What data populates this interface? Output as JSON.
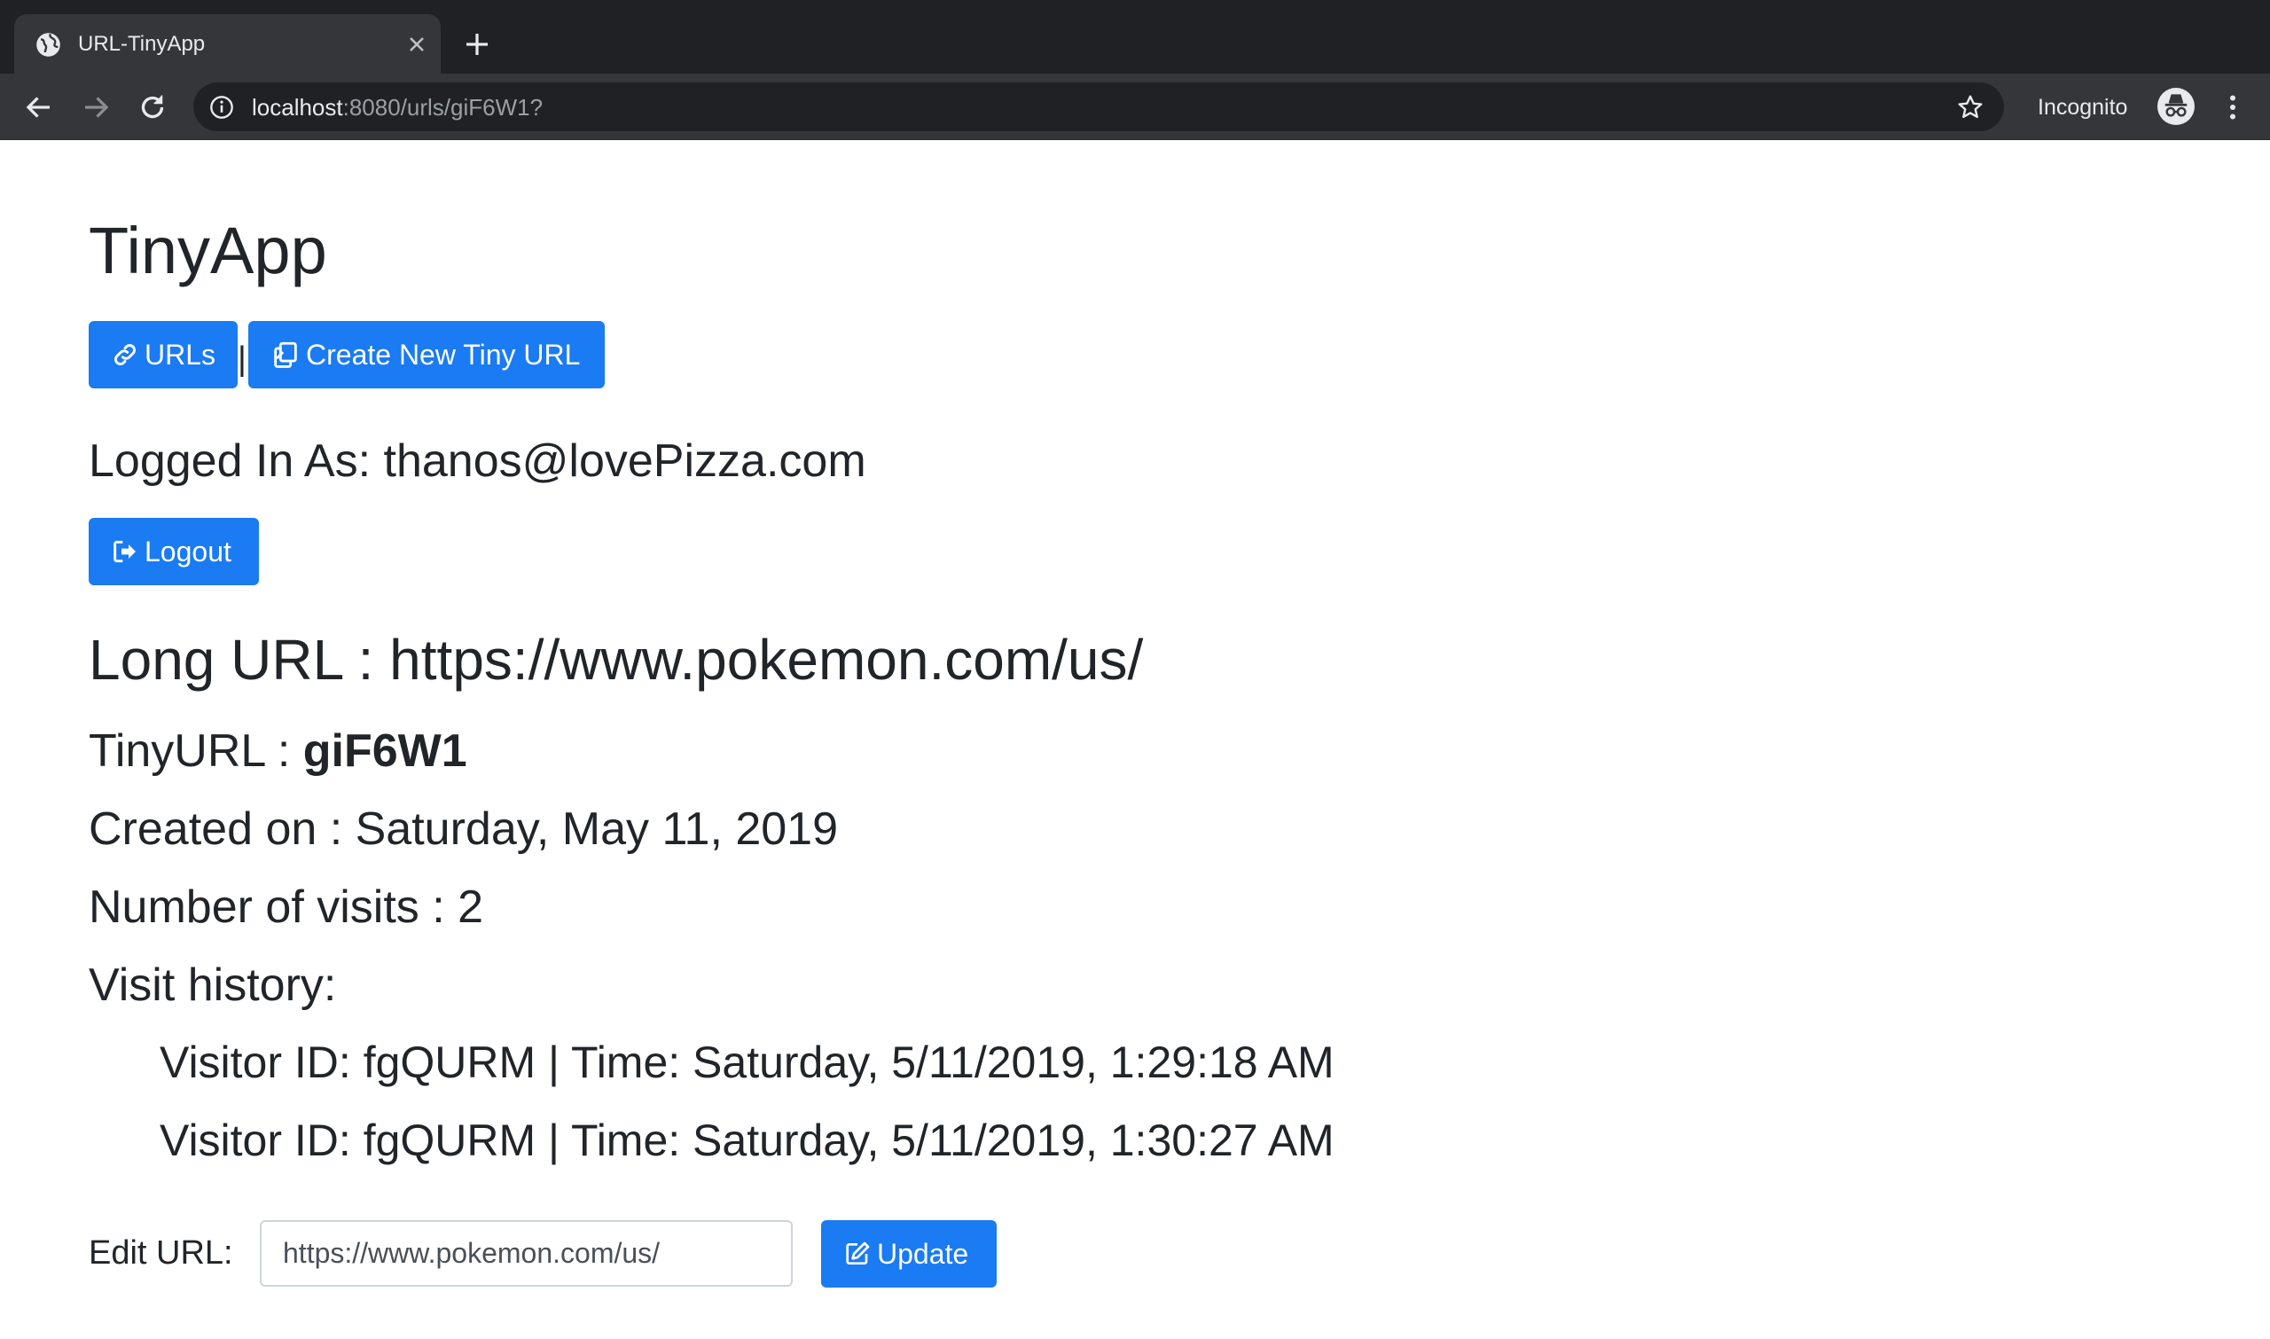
{
  "browser": {
    "tab_title": "URL-TinyApp",
    "url_host": "localhost",
    "url_rest": ":8080/urls/giF6W1?",
    "incognito_label": "Incognito"
  },
  "app": {
    "title": "TinyApp",
    "nav": {
      "urls_label": "URLs",
      "separator": "|",
      "create_label": "Create New Tiny URL"
    },
    "logged_in_text": "Logged In As: thanos@lovePizza.com",
    "logout_label": "Logout"
  },
  "details": {
    "long_url_text": "Long URL : https://www.pokemon.com/us/",
    "tinyurl_prefix": "TinyURL : ",
    "tinyurl_value": "giF6W1",
    "created_text": "Created on : Saturday, May 11, 2019",
    "visits_text": "Number of visits : 2",
    "history_heading": "Visit history:",
    "history": [
      "Visitor ID: fgQURM | Time: Saturday, 5/11/2019, 1:29:18 AM",
      "Visitor ID: fgQURM | Time: Saturday, 5/11/2019, 1:30:27 AM"
    ]
  },
  "edit": {
    "label": "Edit URL:",
    "value": "https://www.pokemon.com/us/",
    "update_label": "Update"
  },
  "colors": {
    "primary": "#1a7bf2",
    "chrome_dark": "#202124",
    "chrome_tab": "#35363a"
  }
}
